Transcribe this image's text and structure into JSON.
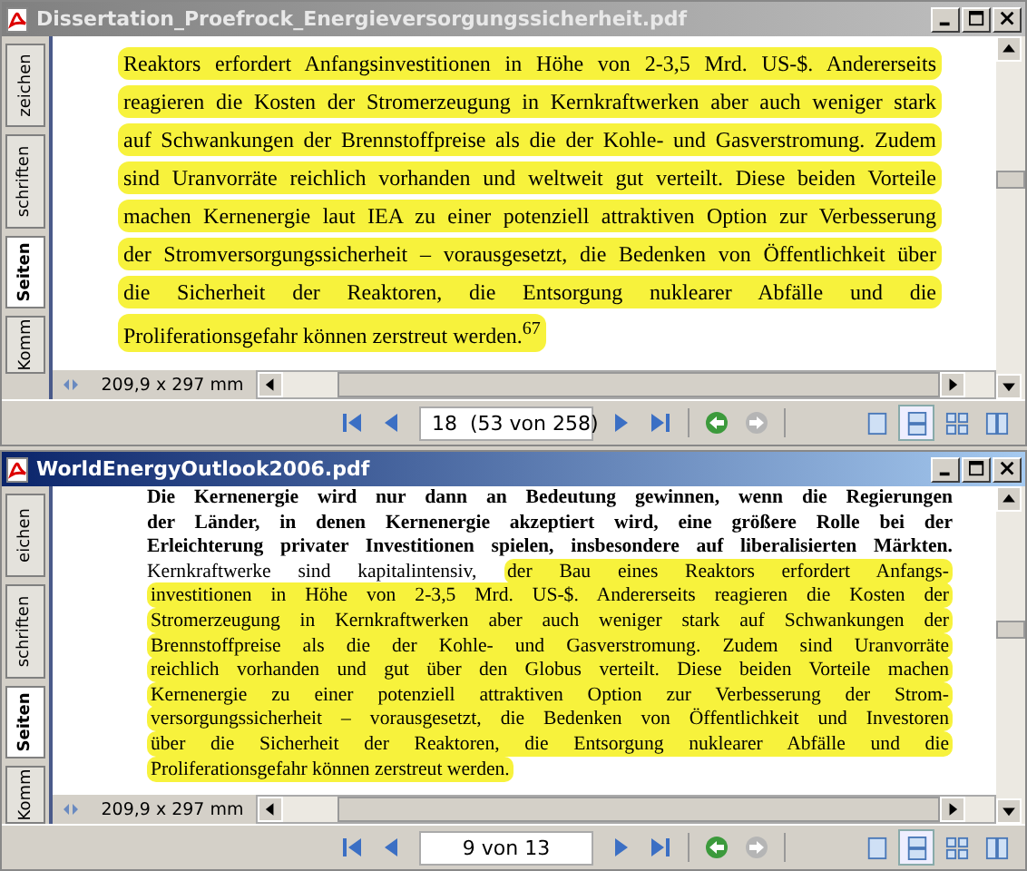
{
  "windows": [
    {
      "title": "Dissertation_Proefrock_Energieversorgungssicherheit.pdf",
      "active": false,
      "side_tabs": [
        {
          "label": "zeichen",
          "selected": false
        },
        {
          "label": "schriften",
          "selected": false
        },
        {
          "label": "Seiten",
          "selected": true
        },
        {
          "label": "Komm",
          "selected": false
        }
      ],
      "lines": [
        {
          "bold": false,
          "justified": true,
          "segments": [
            {
              "text": "Reaktors erfordert Anfangsinvestitionen in Höhe von 2-3,5 Mrd. US-$. Andererseits",
              "highlighted": true
            }
          ]
        },
        {
          "bold": false,
          "justified": true,
          "segments": [
            {
              "text": "reagieren die Kosten der Stromerzeugung in Kernkraftwerken aber auch weniger stark",
              "highlighted": true
            }
          ]
        },
        {
          "bold": false,
          "justified": true,
          "segments": [
            {
              "text": "auf Schwankungen der Brennstoffpreise als die der Kohle- und Gasverstromung. Zudem",
              "highlighted": true
            }
          ]
        },
        {
          "bold": false,
          "justified": true,
          "segments": [
            {
              "text": "sind Uranvorräte reichlich vorhanden und weltweit gut verteilt. Diese beiden Vorteile",
              "highlighted": true
            }
          ]
        },
        {
          "bold": false,
          "justified": true,
          "segments": [
            {
              "text": "machen Kernenergie laut IEA zu einer potenziell attraktiven Option zur Verbesserung",
              "highlighted": true
            }
          ]
        },
        {
          "bold": false,
          "justified": true,
          "segments": [
            {
              "text": "der Stromversorgungssicherheit – vorausgesetzt, die Bedenken von Öffentlichkeit über",
              "highlighted": true
            }
          ]
        },
        {
          "bold": false,
          "justified": true,
          "segments": [
            {
              "text": "die Sicherheit der Reaktoren, die Entsorgung nuklearer Abfälle und die",
              "highlighted": true
            }
          ]
        },
        {
          "bold": false,
          "justified": false,
          "segments": [
            {
              "text": "Proliferationsgefahr können zerstreut werden.$^{67}$",
              "highlighted": true
            }
          ]
        }
      ],
      "page_size": "209,9 x 297 mm",
      "page_field": "18  (53 von 258)",
      "view_buttons": [
        {
          "kind": "single",
          "selected": false
        },
        {
          "kind": "continuous",
          "selected": true
        },
        {
          "kind": "grid",
          "selected": false
        },
        {
          "kind": "facing",
          "selected": false
        }
      ]
    },
    {
      "title": "WorldEnergyOutlook2006.pdf",
      "active": true,
      "side_tabs": [
        {
          "label": "eichen",
          "selected": false
        },
        {
          "label": "schriften",
          "selected": false
        },
        {
          "label": "Seiten",
          "selected": true
        },
        {
          "label": "Komm",
          "selected": false
        }
      ],
      "lines": [
        {
          "bold": true,
          "justified": true,
          "segments": [
            {
              "text": "Die Kernenergie wird nur dann an Bedeutung gewinnen, wenn die Regierungen",
              "highlighted": false
            }
          ]
        },
        {
          "bold": true,
          "justified": true,
          "segments": [
            {
              "text": "der Länder, in denen Kernenergie akzeptiert wird, eine größere Rolle bei der",
              "highlighted": false
            }
          ]
        },
        {
          "bold": true,
          "justified": true,
          "segments": [
            {
              "text": "Erleichterung privater Investitionen spielen, insbesondere auf liberalisierten Märkten.",
              "highlighted": false
            }
          ]
        },
        {
          "bold": false,
          "justified": true,
          "segments": [
            {
              "text": "Kernkraftwerke sind kapitalintensiv,",
              "highlighted": false
            },
            {
              "text": "der Bau eines Reaktors erfordert Anfangs-",
              "highlighted": true
            }
          ]
        },
        {
          "bold": false,
          "justified": true,
          "segments": [
            {
              "text": "investitionen in Höhe von 2-3,5 Mrd. US-$. Andererseits reagieren die Kosten der",
              "highlighted": true
            }
          ]
        },
        {
          "bold": false,
          "justified": true,
          "segments": [
            {
              "text": "Stromerzeugung in Kernkraftwerken aber auch weniger stark auf Schwankungen der",
              "highlighted": true
            }
          ]
        },
        {
          "bold": false,
          "justified": true,
          "segments": [
            {
              "text": "Brennstoffpreise als die der Kohle- und Gasverstromung. Zudem sind Uranvorräte",
              "highlighted": true
            }
          ]
        },
        {
          "bold": false,
          "justified": true,
          "segments": [
            {
              "text": "reichlich vorhanden und gut über den Globus verteilt. Diese beiden Vorteile machen",
              "highlighted": true
            }
          ]
        },
        {
          "bold": false,
          "justified": true,
          "segments": [
            {
              "text": "Kernenergie zu einer potenziell attraktiven Option zur Verbesserung der Strom-",
              "highlighted": true
            }
          ]
        },
        {
          "bold": false,
          "justified": true,
          "segments": [
            {
              "text": "versorgungssicherheit – vorausgesetzt, die Bedenken von Öffentlichkeit und Investoren",
              "highlighted": true
            }
          ]
        },
        {
          "bold": false,
          "justified": true,
          "segments": [
            {
              "text": "über die Sicherheit der Reaktoren, die Entsorgung nuklearer Abfälle und die",
              "highlighted": true
            }
          ]
        },
        {
          "bold": false,
          "justified": false,
          "segments": [
            {
              "text": "Proliferationsgefahr können zerstreut werden.",
              "highlighted": true
            }
          ]
        }
      ],
      "page_size": "209,9 x 297 mm",
      "page_field": "9 von 13",
      "view_buttons": [
        {
          "kind": "single",
          "selected": false
        },
        {
          "kind": "continuous",
          "selected": true
        },
        {
          "kind": "grid",
          "selected": false
        },
        {
          "kind": "facing",
          "selected": false
        }
      ]
    }
  ]
}
